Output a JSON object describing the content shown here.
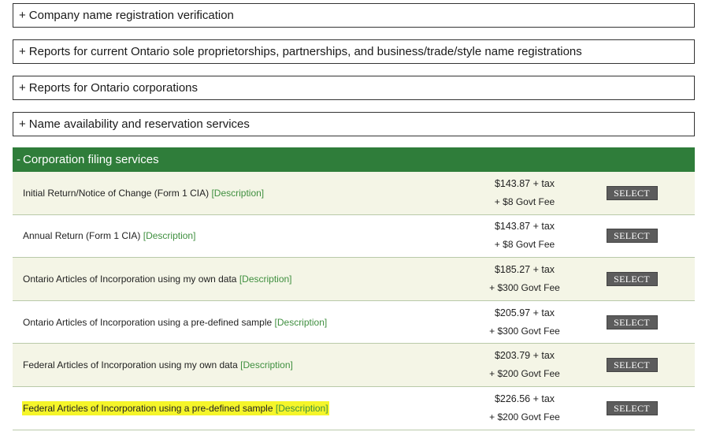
{
  "accordions": [
    {
      "sign": "+",
      "label": "Company name registration verification"
    },
    {
      "sign": "+",
      "label": "Reports for current Ontario sole proprietorships, partnerships, and business/trade/style name registrations"
    },
    {
      "sign": "+",
      "label": "Reports for Ontario corporations"
    },
    {
      "sign": "+",
      "label": "Name availability and reservation services"
    }
  ],
  "expanded": {
    "sign": "-",
    "label": "Corporation filing services",
    "header_color": "#2f7d3a",
    "highlight_color": "#f5f52a",
    "description_label": "[Description]",
    "button_label": "SELECT",
    "rows": [
      {
        "name": "Initial Return/Notice of Change (Form 1 CIA)",
        "price": "$143.87 + tax",
        "fee": "+ $8 Govt Fee"
      },
      {
        "name": "Annual Return (Form 1 CIA)",
        "price": "$143.87 + tax",
        "fee": "+ $8 Govt Fee"
      },
      {
        "name": "Ontario Articles of Incorporation using my own data",
        "price": "$185.27 + tax",
        "fee": "+ $300 Govt Fee"
      },
      {
        "name": "Ontario Articles of Incorporation using a pre-defined sample",
        "price": "$205.97 + tax",
        "fee": "+ $300 Govt Fee"
      },
      {
        "name": "Federal Articles of Incorporation using my own data",
        "price": "$203.79 + tax",
        "fee": "+ $200 Govt Fee"
      },
      {
        "name": "Federal Articles of Incorporation using a pre-defined sample",
        "price": "$226.56 + tax",
        "fee": "+ $200 Govt Fee"
      }
    ]
  }
}
